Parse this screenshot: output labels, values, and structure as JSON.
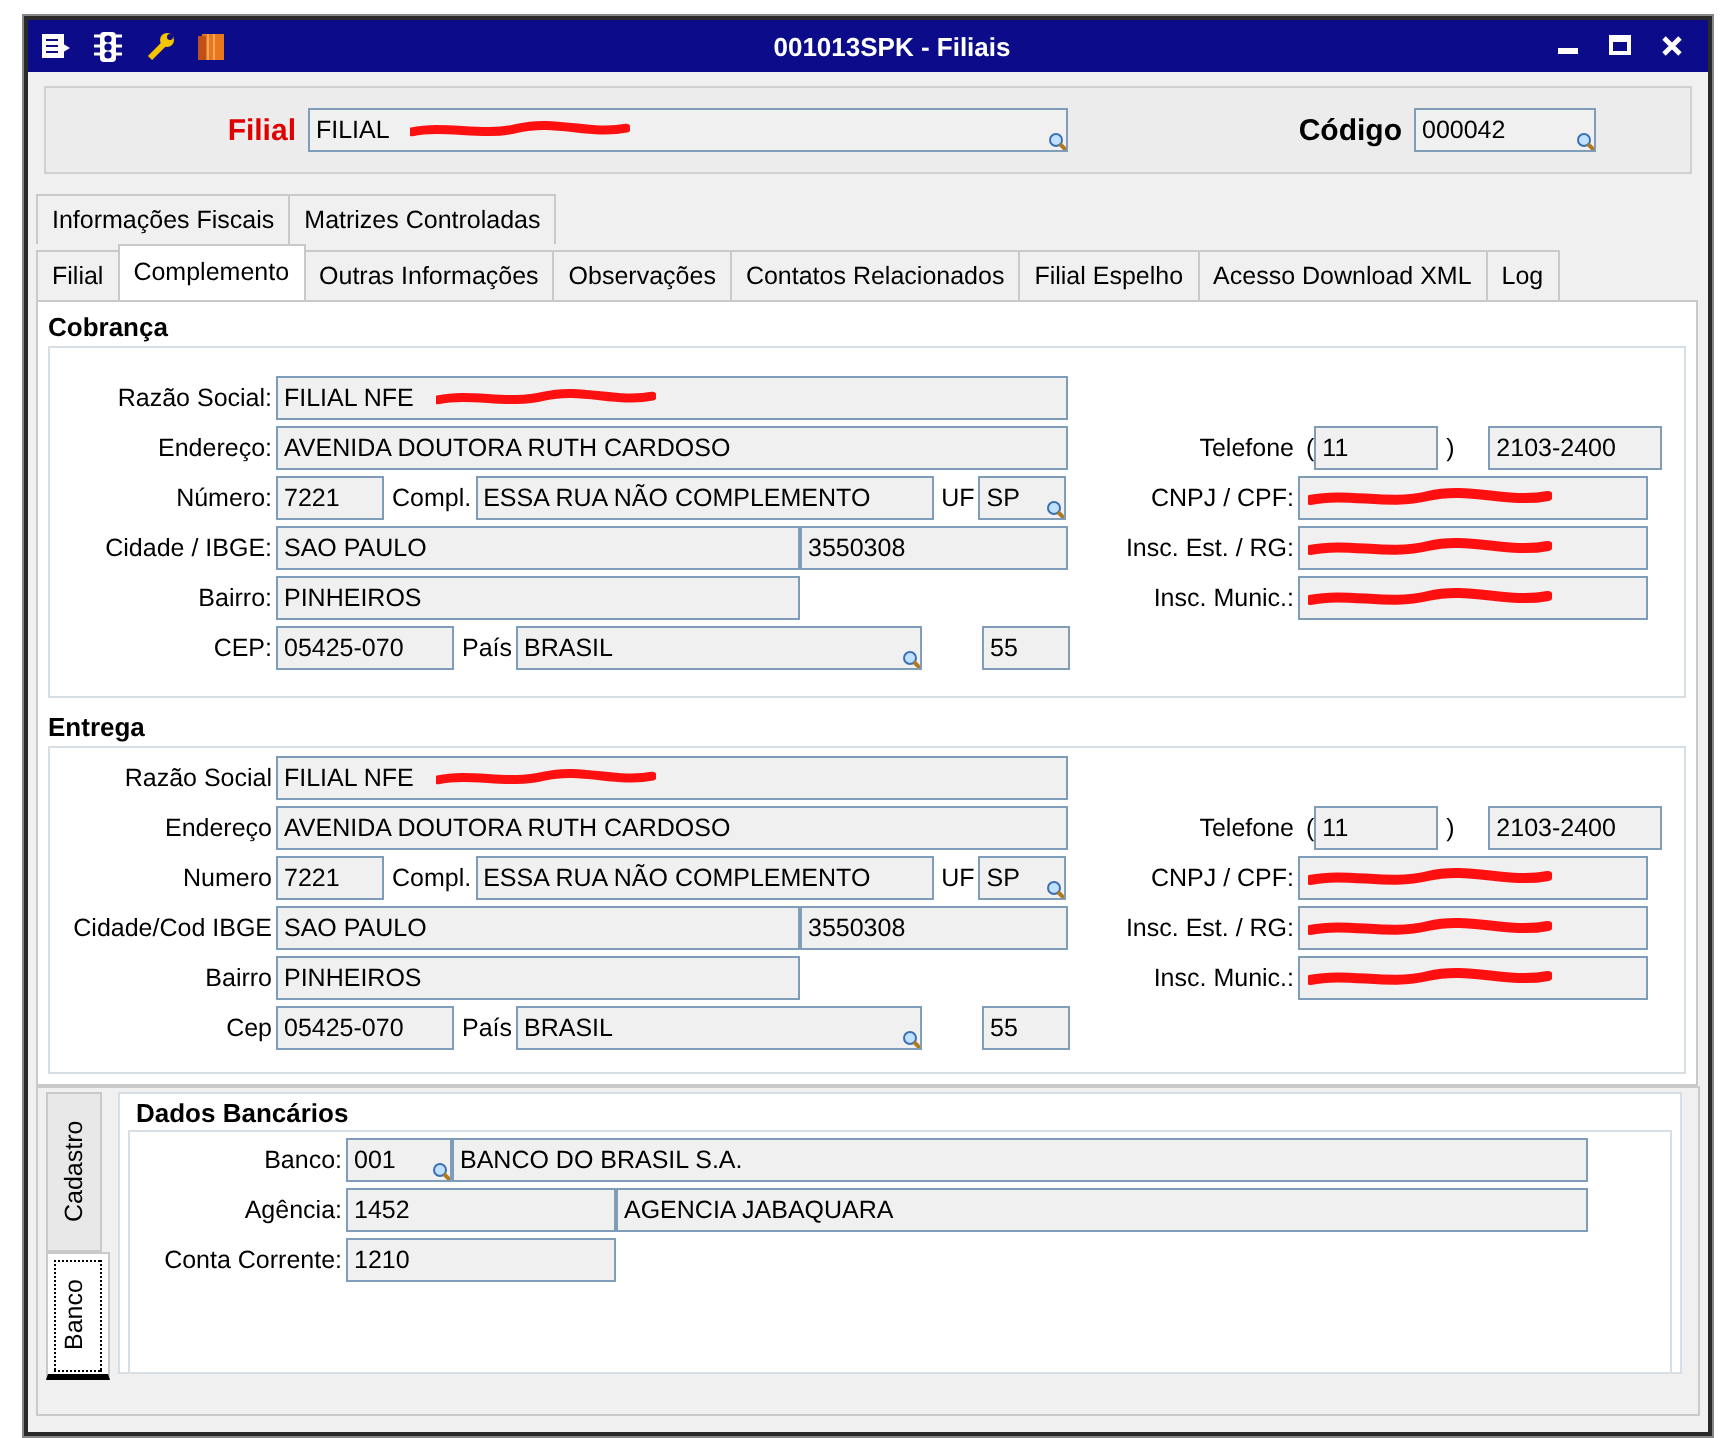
{
  "window": {
    "title": "001013SPK - Filiais"
  },
  "header": {
    "filial": {
      "label": "Filial",
      "value": "FILIAL",
      "redacted": true,
      "lookup": true
    },
    "codigo": {
      "label": "Código",
      "value": "000042",
      "lookup": true
    }
  },
  "tabs_row1": [
    {
      "label": "Informações Fiscais",
      "selected": false
    },
    {
      "label": "Matrizes Controladas",
      "selected": false
    }
  ],
  "tabs_row2": [
    {
      "label": "Filial",
      "selected": false
    },
    {
      "label": "Complemento",
      "selected": true
    },
    {
      "label": "Outras Informações",
      "selected": false
    },
    {
      "label": "Observações",
      "selected": false
    },
    {
      "label": "Contatos Relacionados",
      "selected": false
    },
    {
      "label": "Filial Espelho",
      "selected": false
    },
    {
      "label": "Acesso Download XML",
      "selected": false
    },
    {
      "label": "Log",
      "selected": false
    }
  ],
  "sections": [
    {
      "title": "Cobrança",
      "razao_social": {
        "label": "Razão Social:",
        "value": "FILIAL NFE",
        "redacted": true
      },
      "endereco": {
        "label": "Endereço:",
        "value": "AVENIDA DOUTORA RUTH CARDOSO"
      },
      "numero": {
        "label": "Número:",
        "value": "7221"
      },
      "complemento": {
        "label": "Compl.",
        "value": "ESSA RUA NÃO COMPLEMENTO"
      },
      "uf": {
        "label": "UF",
        "value": "SP",
        "lookup": true
      },
      "cidade": {
        "label": "Cidade / IBGE:",
        "value": "SAO PAULO"
      },
      "ibge": {
        "value": "3550308"
      },
      "bairro": {
        "label": "Bairro:",
        "value": "PINHEIROS"
      },
      "cep": {
        "label": "CEP:",
        "value": "05425-070"
      },
      "pais": {
        "label": "País",
        "value": "BRASIL",
        "lookup": true
      },
      "pais_codigo": {
        "value": "55"
      },
      "telefone": {
        "label": "Telefone",
        "open": "(",
        "ddd": "11",
        "close": ")",
        "numero": "2103-2400"
      },
      "cnpj": {
        "label": "CNPJ / CPF:",
        "redacted": true
      },
      "insc_est": {
        "label": "Insc. Est. / RG:",
        "redacted": true
      },
      "insc_munic": {
        "label": "Insc. Munic.:",
        "redacted": true
      }
    },
    {
      "title": "Entrega",
      "razao_social": {
        "label": "Razão Social",
        "value": "FILIAL NFE",
        "redacted": true
      },
      "endereco": {
        "label": "Endereço",
        "value": "AVENIDA DOUTORA RUTH CARDOSO"
      },
      "numero": {
        "label": "Numero",
        "value": "7221"
      },
      "complemento": {
        "label": "Compl.",
        "value": "ESSA RUA NÃO COMPLEMENTO"
      },
      "uf": {
        "label": "UF",
        "value": "SP",
        "lookup": true
      },
      "cidade": {
        "label": "Cidade/Cod IBGE",
        "value": "SAO PAULO"
      },
      "ibge": {
        "value": "3550308"
      },
      "bairro": {
        "label": "Bairro",
        "value": "PINHEIROS"
      },
      "cep": {
        "label": "Cep",
        "value": "05425-070"
      },
      "pais": {
        "label": "País",
        "value": "BRASIL",
        "lookup": true
      },
      "pais_codigo": {
        "value": "55"
      },
      "telefone": {
        "label": "Telefone",
        "open": "(",
        "ddd": "11",
        "close": ")",
        "numero": "2103-2400"
      },
      "cnpj": {
        "label": "CNPJ / CPF:",
        "redacted": true
      },
      "insc_est": {
        "label": "Insc. Est. / RG:",
        "redacted": true
      },
      "insc_munic": {
        "label": "Insc. Munic.:",
        "redacted": true
      }
    }
  ],
  "side_tabs": [
    {
      "label": "Cadastro",
      "selected": false
    },
    {
      "label": "Banco",
      "selected": true
    }
  ],
  "bank": {
    "title": "Dados Bancários",
    "banco": {
      "label": "Banco:",
      "code": "001",
      "name": "BANCO DO BRASIL S.A.",
      "lookup": true
    },
    "agencia": {
      "label": "Agência:",
      "code": "1452",
      "name": "AGENCIA JABAQUARA"
    },
    "conta": {
      "label": "Conta Corrente:",
      "value": "1210"
    }
  }
}
